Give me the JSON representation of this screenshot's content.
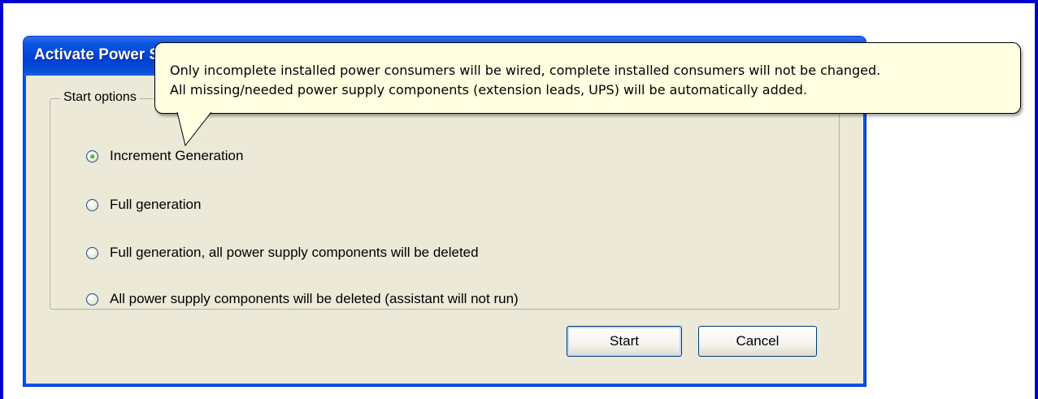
{
  "dialog": {
    "title": "Activate Power Supply Assistant",
    "group_label": "Start options",
    "options": [
      {
        "label": "Increment Generation",
        "checked": true
      },
      {
        "label": "Full generation",
        "checked": false
      },
      {
        "label": "Full generation, all power supply components will be deleted",
        "checked": false
      },
      {
        "label": "All power supply components will be deleted (assistant will not run)",
        "checked": false
      }
    ],
    "start_label": "Start",
    "cancel_label": "Cancel"
  },
  "tooltip": {
    "line1": "Only incomplete installed power consumers will be wired, complete installed consumers will not be changed.",
    "line2": "All missing/needed power supply components (extension leads, UPS) will be automatically added."
  },
  "colors": {
    "frame": "#0000cc",
    "titlebar": "#0040d4",
    "dialog_bg": "#ece9d8",
    "tooltip_bg": "#ffffe1"
  }
}
